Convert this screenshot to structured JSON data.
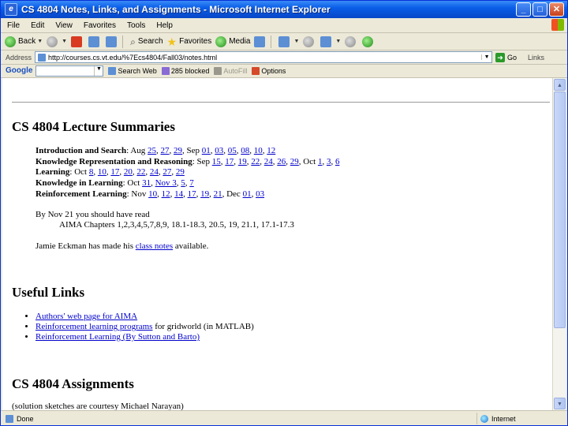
{
  "window": {
    "title": "CS 4804 Notes, Links, and Assignments - Microsoft Internet Explorer",
    "minimize": "_",
    "maximize": "□",
    "close": "✕"
  },
  "menu": [
    "File",
    "Edit",
    "View",
    "Favorites",
    "Tools",
    "Help"
  ],
  "toolbar": {
    "back": "Back",
    "search": "Search",
    "favorites": "Favorites",
    "media": "Media"
  },
  "address": {
    "label": "Address",
    "url": "http://courses.cs.vt.edu/%7Ecs4804/Fall03/notes.html",
    "go": "Go",
    "links": "Links"
  },
  "googlebar": {
    "logo": "Google",
    "search_web": "Search Web",
    "blocked": "285 blocked",
    "autofill": "AutoFill",
    "options": "Options"
  },
  "page": {
    "lecture_heading": "CS 4804 Lecture Summaries",
    "intro_label": "Introduction and Search",
    "intro_pre": ": Aug ",
    "intro_links": [
      "25",
      "27",
      "29"
    ],
    "intro_sep": ", Sep ",
    "intro_links2": [
      "01",
      "03",
      "05",
      "08",
      "10",
      "12"
    ],
    "kr_label": "Knowledge Representation and Reasoning",
    "kr_pre": ": Sep ",
    "kr_links": [
      "15",
      "17",
      "19",
      "22",
      "24",
      "26",
      "29"
    ],
    "kr_sep": ", Oct ",
    "kr_links2": [
      "1",
      "3",
      "6"
    ],
    "learn_label": "Learning",
    "learn_pre": ": Oct ",
    "learn_links": [
      "8",
      "10",
      "17",
      "20",
      "22",
      "24",
      "27",
      "29"
    ],
    "kil_label": "Knowledge in Learning",
    "kil_pre": ": Oct ",
    "kil_links": [
      "31"
    ],
    "kil_sep": ", ",
    "kil_nov": "Nov 3",
    "kil_links2": [
      "5",
      "7"
    ],
    "rl_label": "Reinforcement Learning",
    "rl_pre": ": Nov ",
    "rl_links": [
      "10",
      "12",
      "14",
      "17",
      "19",
      "21"
    ],
    "rl_sep": ", Dec ",
    "rl_links2": [
      "01",
      "03"
    ],
    "read_line": "By Nov 21 you should have read",
    "aima_line": "AIMA Chapters 1,2,3,4,5,7,8,9, 18.1-18.3, 20.5, 19, 21.1, 17.1-17.3",
    "notes_pre": "Jamie Eckman has made his ",
    "notes_link": "class notes",
    "notes_post": " available.",
    "useful_heading": "Useful Links",
    "link1": "Authors' web page for AIMA",
    "link2": "Reinforcement learning programs",
    "link2_post": " for gridworld (in MATLAB)",
    "link3": "Reinforcement Learning (By Sutton and Barto)",
    "assign_heading": "CS 4804 Assignments",
    "assign_note": "(solution sketches are courtesy Michael Narayan)"
  },
  "status": {
    "text": "Done",
    "zone": "Internet"
  }
}
